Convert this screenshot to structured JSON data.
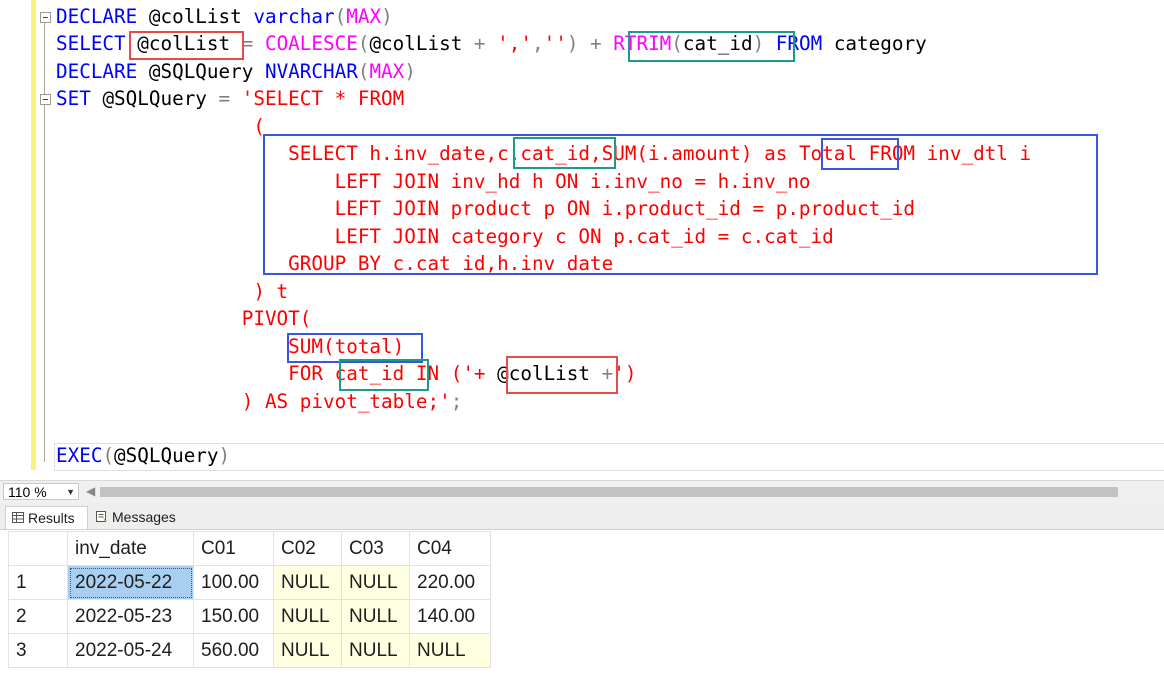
{
  "editor": {
    "lines": [
      [
        [
          "kw",
          "DECLARE "
        ],
        [
          "id",
          "@colList "
        ],
        [
          "kw",
          "varchar"
        ],
        [
          "op",
          "("
        ],
        [
          "fn",
          "MAX"
        ],
        [
          "op",
          ")"
        ]
      ],
      [
        [
          "kw",
          "SELECT "
        ],
        [
          "id",
          "@colList"
        ],
        [
          "op",
          " = "
        ],
        [
          "fn",
          "COALESCE"
        ],
        [
          "op",
          "("
        ],
        [
          "id",
          "@colList"
        ],
        [
          "op",
          " + "
        ],
        [
          "str",
          "','"
        ],
        [
          "op",
          ","
        ],
        [
          "str",
          "''"
        ],
        [
          "op",
          ") + "
        ],
        [
          "fn",
          "RTRIM"
        ],
        [
          "op",
          "("
        ],
        [
          "id",
          "cat_id"
        ],
        [
          "op",
          ")"
        ],
        [
          "kw",
          " FROM "
        ],
        [
          "id",
          "category"
        ]
      ],
      [
        [
          "kw",
          "DECLARE "
        ],
        [
          "id",
          "@SQLQuery "
        ],
        [
          "kw",
          "NVARCHAR"
        ],
        [
          "op",
          "("
        ],
        [
          "fn",
          "MAX"
        ],
        [
          "op",
          ")"
        ]
      ],
      [
        [
          "kw",
          "SET "
        ],
        [
          "id",
          "@SQLQuery"
        ],
        [
          "op",
          " = "
        ],
        [
          "str",
          "'SELECT * FROM"
        ]
      ],
      [
        [
          "str",
          "                 ("
        ]
      ],
      [
        [
          "str",
          "                    SELECT h.inv_date,"
        ],
        [
          "str",
          "c.cat_id"
        ],
        [
          "str",
          ",SUM(i.amount) as "
        ],
        [
          "str",
          "Total"
        ],
        [
          "str",
          " FROM inv_dtl i"
        ]
      ],
      [
        [
          "str",
          "                        LEFT JOIN inv_hd h ON i.inv_no = h.inv_no"
        ]
      ],
      [
        [
          "str",
          "                        LEFT JOIN product p ON i.product_id = p.product_id"
        ]
      ],
      [
        [
          "str",
          "                        LEFT JOIN category c ON p.cat_id = c.cat_id"
        ]
      ],
      [
        [
          "str",
          "                    GROUP BY c.cat_id,h.inv_date"
        ]
      ],
      [
        [
          "str",
          "                 ) t"
        ]
      ],
      [
        [
          "str",
          "                PIVOT("
        ]
      ],
      [
        [
          "str",
          "                    SUM(total)"
        ]
      ],
      [
        [
          "str",
          "                    FOR "
        ],
        [
          "str",
          "cat_id"
        ],
        [
          "str",
          " IN ("
        ],
        [
          "str",
          "'+ "
        ],
        [
          "id",
          "@colList"
        ],
        [
          "op",
          " +"
        ],
        [
          "str",
          "')"
        ]
      ],
      [
        [
          "str",
          "                ) AS pivot_table;'"
        ],
        [
          "op",
          ";"
        ]
      ],
      [],
      [
        [
          "kw",
          "EXEC"
        ],
        [
          "op",
          "("
        ],
        [
          "id",
          "@SQLQuery"
        ],
        [
          "op",
          ")"
        ]
      ]
    ]
  },
  "statusbar": {
    "zoom": "110 %"
  },
  "tabs": {
    "results_label": "Results",
    "messages_label": "Messages"
  },
  "results": {
    "columns": [
      "",
      "inv_date",
      "C01",
      "C02",
      "C03",
      "C04"
    ],
    "rows": [
      [
        "1",
        "2022-05-22",
        "100.00",
        "NULL",
        "NULL",
        "220.00"
      ],
      [
        "2",
        "2022-05-23",
        "150.00",
        "NULL",
        "NULL",
        "140.00"
      ],
      [
        "3",
        "2022-05-24",
        "560.00",
        "NULL",
        "NULL",
        "NULL"
      ]
    ]
  },
  "colors": {
    "keyword": "#0000ff",
    "string": "#ff0000",
    "function": "#ff00ff",
    "operator": "#808080",
    "highlight_red": "#e84a4a",
    "highlight_teal": "#1a9c86",
    "highlight_blue": "#3a55e0",
    "null_cell": "#ffffe1",
    "selected_cell": "#a8cef0"
  }
}
